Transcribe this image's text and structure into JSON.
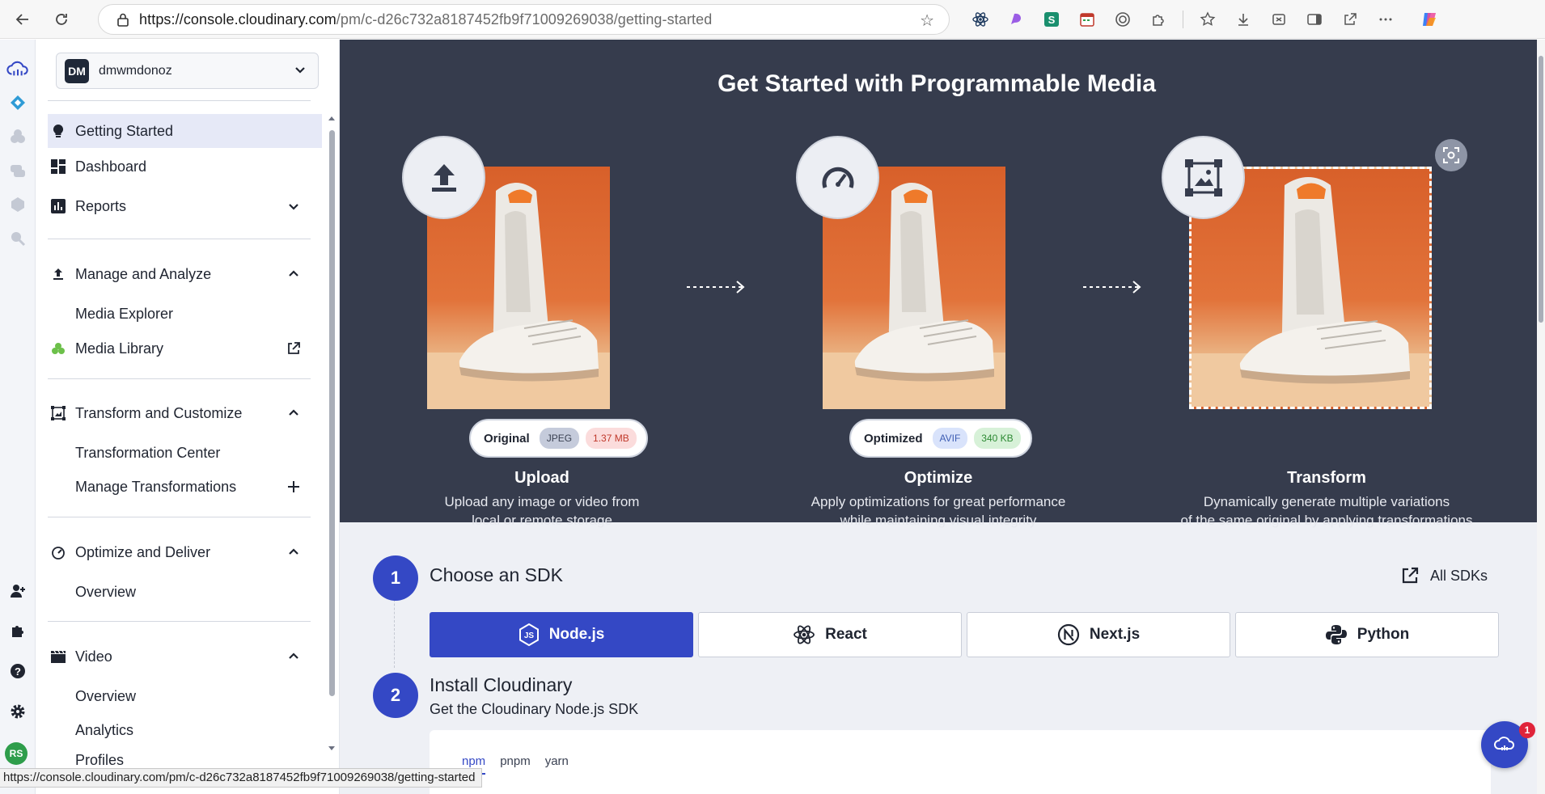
{
  "browser": {
    "url_host": "https://console.cloudinary.com",
    "url_path": "/pm/c-d26c732a8187452fb9f71009269038/getting-started",
    "status_url": "https://console.cloudinary.com/pm/c-d26c732a8187452fb9f71009269038/getting-started"
  },
  "rail": {
    "avatar": "RS"
  },
  "sidebar": {
    "account_badge": "DM",
    "account_name": "dmwmdonoz",
    "items": {
      "getting_started": "Getting Started",
      "dashboard": "Dashboard",
      "reports": "Reports",
      "manage_analyze": "Manage and Analyze",
      "media_explorer": "Media Explorer",
      "media_library": "Media Library",
      "transform_customize": "Transform and Customize",
      "transformation_center": "Transformation Center",
      "manage_transformations": "Manage Transformations",
      "optimize_deliver": "Optimize and Deliver",
      "overview_od": "Overview",
      "video": "Video",
      "overview_video": "Overview",
      "analytics": "Analytics",
      "profiles": "Profiles"
    }
  },
  "hero": {
    "title": "Get Started with Programmable Media",
    "upload": {
      "title": "Upload",
      "desc1": "Upload any image or video from",
      "desc2": "local or remote storage",
      "pill_label": "Original",
      "format": "JPEG",
      "size": "1.37 MB"
    },
    "optimize": {
      "title": "Optimize",
      "desc1": "Apply optimizations for great performance",
      "desc2": "while maintaining visual integrity",
      "pill_label": "Optimized",
      "format": "AVIF",
      "size": "340 KB"
    },
    "transform": {
      "title": "Transform",
      "desc1": "Dynamically generate multiple variations",
      "desc2": "of the same original by applying transformations"
    }
  },
  "sdk": {
    "step1_num": "1",
    "step1_title": "Choose an SDK",
    "all_sdks": "All SDKs",
    "tabs": [
      "Node.js",
      "React",
      "Next.js",
      "Python"
    ],
    "step2_num": "2",
    "step2_title": "Install Cloudinary",
    "step2_sub": "Get the Cloudinary Node.js SDK",
    "pm_tabs": [
      "npm",
      "pnpm",
      "yarn"
    ]
  },
  "chat": {
    "badge": "1"
  },
  "colors": {
    "accent": "#3448c5",
    "hero_bg": "#363c4d"
  }
}
